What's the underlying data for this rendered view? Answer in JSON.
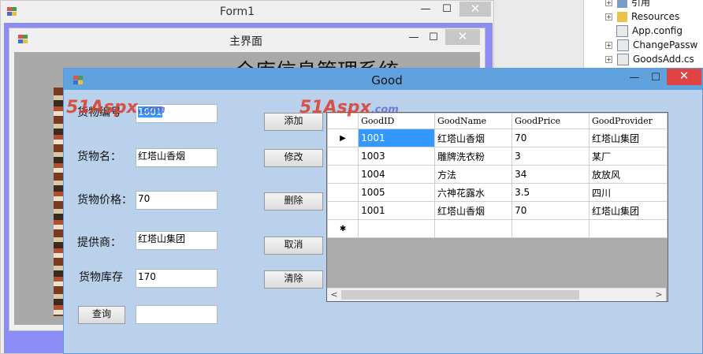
{
  "form1": {
    "title": "Form1",
    "min": "—",
    "max": "☐",
    "close": "✕"
  },
  "main_window": {
    "title": "主界面",
    "heading": "仓库信息管理系统",
    "min": "—",
    "max": "☐",
    "close": "✕"
  },
  "good_window": {
    "title": "Good",
    "min": "—",
    "max": "☐",
    "close": "✕"
  },
  "solution_tree": {
    "items": [
      {
        "label": "引用"
      },
      {
        "label": "Resources"
      },
      {
        "label": "App.config"
      },
      {
        "label": "ChangePassw"
      },
      {
        "label": "GoodsAdd.cs"
      }
    ]
  },
  "form": {
    "good_id": {
      "label": "货物编号",
      "value": "1001"
    },
    "good_name": {
      "label": "货物名：",
      "value": "红塔山香烟"
    },
    "good_price": {
      "label": "货物价格：",
      "value": "70"
    },
    "good_provider": {
      "label": "提供商：",
      "value": "红塔山集团"
    },
    "good_stock": {
      "label": "货物库存",
      "value": "170"
    },
    "query_button": "查询",
    "query_input": ""
  },
  "buttons": {
    "add": "添加",
    "edit": "修改",
    "delete": "删除",
    "cancel": "取消",
    "clear": "清除"
  },
  "grid": {
    "columns": [
      "GoodID",
      "GoodName",
      "GoodPrice",
      "GoodProvider"
    ],
    "rows": [
      [
        "1001",
        "红塔山香烟",
        "70",
        "红塔山集团"
      ],
      [
        "1003",
        "雕牌洗衣粉",
        "3",
        "某厂"
      ],
      [
        "1004",
        "方法",
        "34",
        "放放风"
      ],
      [
        "1005",
        "六神花露水",
        "3.5",
        "四川"
      ],
      [
        "1001",
        "红塔山香烟",
        "70",
        "红塔山集团"
      ]
    ],
    "current_row_marker": "▶",
    "new_row_marker": "✱",
    "scroll_left": "<",
    "scroll_right": ">"
  },
  "watermark": {
    "brand": "51Aspx",
    "suffix": ".com"
  },
  "colors": {
    "good_bg": "#b9d1ea",
    "titlebar_active": "#5fa2dd",
    "close_red": "#e04343",
    "form_border": "#7f7ff0",
    "selected_cell": "#3399ff"
  }
}
